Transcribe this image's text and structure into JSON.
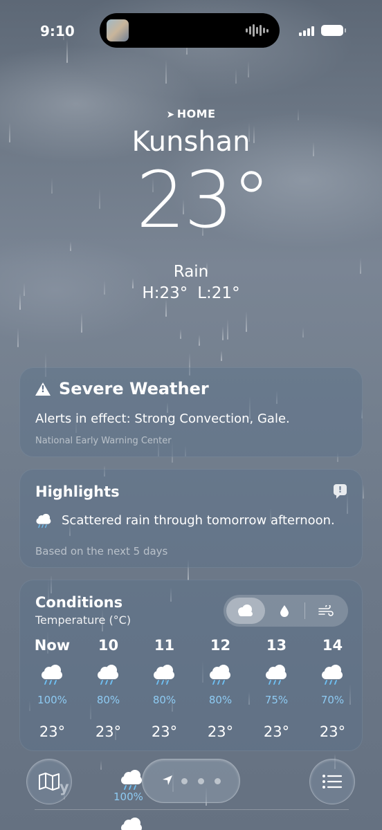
{
  "status_bar": {
    "time": "9:10"
  },
  "hero": {
    "location_tag": "HOME",
    "city": "Kunshan",
    "temperature": "23°",
    "condition": "Rain",
    "high": "H:23°",
    "low": "L:21°"
  },
  "severe": {
    "title": "Severe Weather",
    "body": "Alerts in effect: Strong Convection, Gale.",
    "source": "National Early Warning Center"
  },
  "highlights": {
    "title": "Highlights",
    "text": "Scattered rain through tomorrow afternoon.",
    "footer": "Based on the next 5 days"
  },
  "conditions": {
    "title": "Conditions",
    "subtitle": "Temperature (°C)",
    "segments": [
      "cloud-icon",
      "drop-icon",
      "wind-icon"
    ],
    "hours": [
      {
        "label": "Now",
        "icon": "rain-cloud-icon",
        "precip": "100%",
        "temp": "23°"
      },
      {
        "label": "10",
        "icon": "rain-cloud-icon",
        "precip": "80%",
        "temp": "23°"
      },
      {
        "label": "11",
        "icon": "rain-cloud-icon",
        "precip": "80%",
        "temp": "23°"
      },
      {
        "label": "12",
        "icon": "rain-cloud-icon",
        "precip": "80%",
        "temp": "23°"
      },
      {
        "label": "13",
        "icon": "rain-cloud-icon",
        "precip": "75%",
        "temp": "23°"
      },
      {
        "label": "14",
        "icon": "rain-cloud-icon",
        "precip": "70%",
        "temp": "23°"
      }
    ]
  },
  "forecast_peek": {
    "day_fragment": "y",
    "precip": "100%"
  },
  "colors": {
    "accent_precip": "#8ecbf3",
    "card_bg": "#5c708a"
  }
}
